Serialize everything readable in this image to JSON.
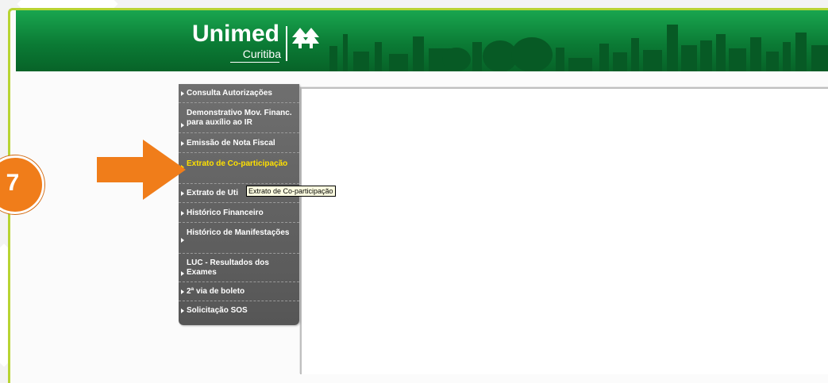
{
  "banner": {
    "logo_word": "Unimed",
    "logo_city": "Curitiba"
  },
  "menu": {
    "items": [
      {
        "label": "Consulta Autorizações"
      },
      {
        "label": "Demonstrativo Mov. Financ. para auxílio ao IR"
      },
      {
        "label": "Emissão de Nota Fiscal"
      },
      {
        "label": "Extrato de Co-participação"
      },
      {
        "label": "Extrato de Uti"
      },
      {
        "label": "Histórico Financeiro"
      },
      {
        "label": "Histórico de Manifestações"
      },
      {
        "label": "LUC - Resultados dos Exames"
      },
      {
        "label": "2ª via de boleto"
      },
      {
        "label": "Solicitação SOS"
      }
    ]
  },
  "tooltip": "Extrato de Co-participação",
  "step_badge": "7",
  "colors": {
    "accent_green": "#0b7b35",
    "active_menu_text": "#ffe000",
    "annotation_orange": "#f07d1a",
    "frame_lime": "#b8d433"
  },
  "icons": [
    "unimed-trees-icon",
    "menu-arrow-icon",
    "pointer-arrow-icon"
  ]
}
